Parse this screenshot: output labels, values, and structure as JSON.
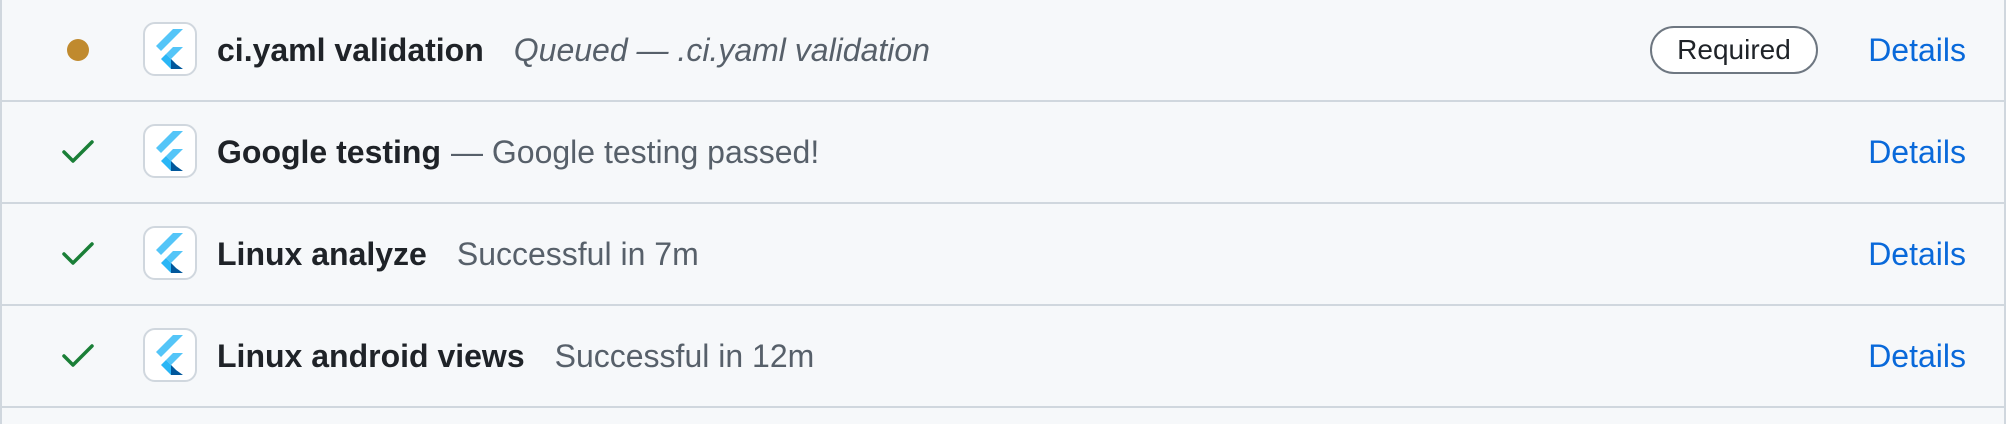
{
  "colors": {
    "queued": "#c08a2e",
    "success": "#1a7f37",
    "link": "#0969da",
    "flutter_light": "#54c5f8",
    "flutter_dark": "#01579b"
  },
  "checks": [
    {
      "status": "queued",
      "status_icon": "queued-dot-icon",
      "app_icon": "flutter-logo-icon",
      "name": "ci.yaml validation",
      "description": "Queued — .ci.yaml validation",
      "badge": "Required",
      "action": "Details"
    },
    {
      "status": "success",
      "status_icon": "checkmark-icon",
      "app_icon": "flutter-logo-icon",
      "name": "Google testing",
      "description": "— Google testing passed!",
      "action": "Details"
    },
    {
      "status": "success",
      "status_icon": "checkmark-icon",
      "app_icon": "flutter-logo-icon",
      "name": "Linux analyze",
      "description": "Successful in 7m",
      "action": "Details"
    },
    {
      "status": "success",
      "status_icon": "checkmark-icon",
      "app_icon": "flutter-logo-icon",
      "name": "Linux android views",
      "description": "Successful in 12m",
      "action": "Details"
    }
  ]
}
